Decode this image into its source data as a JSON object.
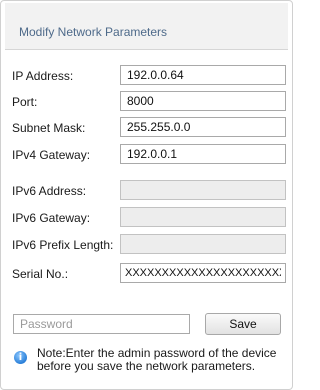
{
  "panel": {
    "title": "Modify Network Parameters"
  },
  "fields": [
    {
      "label": "IP Address:",
      "value": "192.0.0.64",
      "enabled": true
    },
    {
      "label": "Port:",
      "value": "8000",
      "enabled": true
    },
    {
      "label": "Subnet Mask:",
      "value": "255.255.0.0",
      "enabled": true
    },
    {
      "label": "IPv4 Gateway:",
      "value": "192.0.0.1",
      "enabled": true
    },
    {
      "label": "IPv6 Address:",
      "value": "",
      "enabled": false
    },
    {
      "label": "IPv6 Gateway:",
      "value": "",
      "enabled": false
    },
    {
      "label": "IPv6 Prefix Length:",
      "value": "",
      "enabled": false
    },
    {
      "label": "Serial No.:",
      "value": "XXXXXXXXXXXXXXXXXXXXXX",
      "enabled": true
    }
  ],
  "password": {
    "placeholder": "Password",
    "value": ""
  },
  "save_label": "Save",
  "note": {
    "icon": "info-icon",
    "text": "Note:Enter the admin password of the device before you save the network parameters."
  },
  "colors": {
    "title": "#4e6a8a",
    "header_bg": "#f2f2f2",
    "disabled_field_bg": "#ededed",
    "info_icon": "#2a7fd8"
  }
}
